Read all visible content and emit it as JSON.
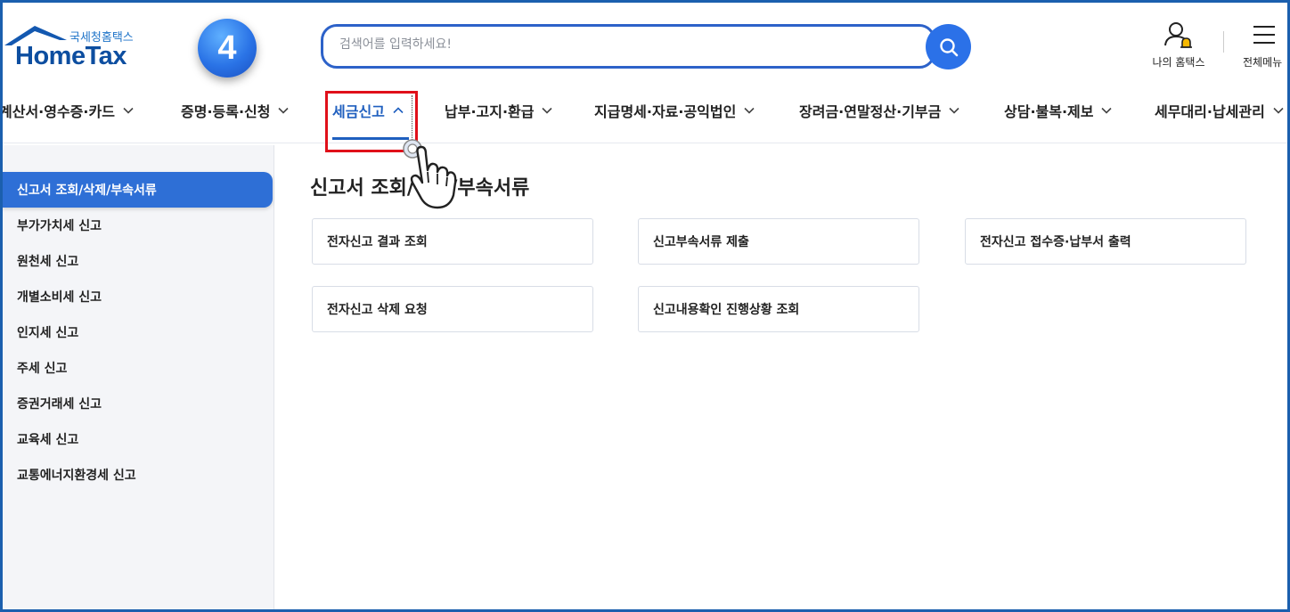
{
  "header": {
    "logo_sub": "국세청홈택스",
    "logo_main": "HomeTax",
    "step_number": "4",
    "search": {
      "placeholder": "검색어를 입력하세요!"
    },
    "my_hometax_label": "나의 홈택스",
    "all_menu_label": "전체메뉴"
  },
  "nav": {
    "items": [
      {
        "label": "계산서·영수증·카드"
      },
      {
        "label": "증명·등록·신청"
      },
      {
        "label": "세금신고",
        "active": true
      },
      {
        "label": "납부·고지·환급"
      },
      {
        "label": "지급명세·자료·공익법인"
      },
      {
        "label": "장려금·연말정산·기부금"
      },
      {
        "label": "상담·불복·제보"
      },
      {
        "label": "세무대리·납세관리"
      }
    ]
  },
  "sidebar": {
    "items": [
      {
        "label": "신고서 조회/삭제/부속서류",
        "active": true
      },
      {
        "label": "부가가치세 신고"
      },
      {
        "label": "원천세 신고"
      },
      {
        "label": "개별소비세 신고"
      },
      {
        "label": "인지세 신고"
      },
      {
        "label": "주세 신고"
      },
      {
        "label": "증권거래세 신고"
      },
      {
        "label": "교육세 신고"
      },
      {
        "label": "교통에너지환경세 신고"
      }
    ]
  },
  "main": {
    "title": "신고서 조회/삭제/부속서류",
    "cards": [
      {
        "label": "전자신고 결과 조회"
      },
      {
        "label": "신고부속서류 제출"
      },
      {
        "label": "전자신고 접수증·납부서 출력"
      },
      {
        "label": "전자신고 삭제 요청"
      },
      {
        "label": "신고내용확인 진행상황 조회"
      }
    ]
  },
  "colors": {
    "brand_blue": "#1f5fbf",
    "highlight_red": "#e0101a",
    "sidebar_active": "#2e6fd6",
    "frame": "#1b5fae"
  },
  "icons": [
    "house-roof-icon",
    "search-icon",
    "user-bell-icon",
    "hamburger-menu-icon",
    "chevron-down-icon",
    "chevron-up-icon",
    "pointer-hand-icon"
  ]
}
